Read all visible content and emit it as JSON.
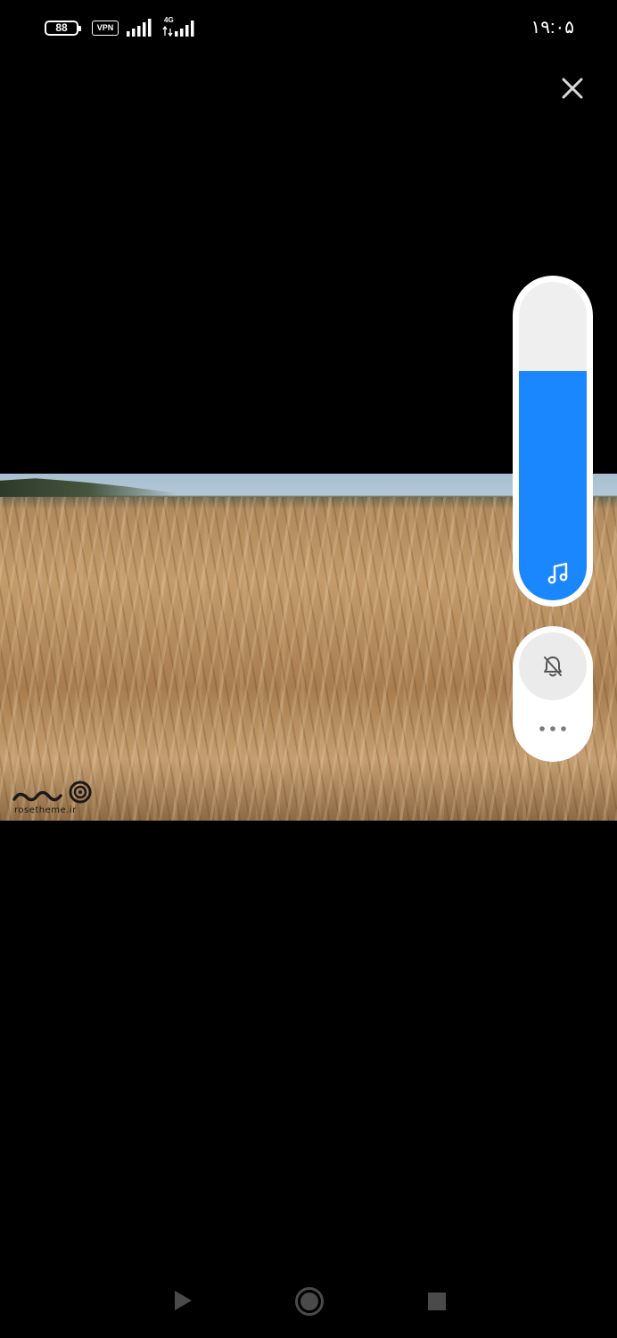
{
  "status_bar": {
    "battery_level": "88",
    "vpn_label": "VPN",
    "network_type": "4G",
    "time": "۱۹:۰۵"
  },
  "media": {
    "watermark_text": "rosetheme.ir"
  },
  "volume": {
    "level": 0.72,
    "accent_color": "#1b87ff",
    "stream_icon": "music-note-icon",
    "mute_icon": "bell-off-icon",
    "more_icon": "more-dots-icon"
  },
  "icons": {
    "close": "close-icon",
    "nav_back": "triangle-back-icon",
    "nav_home": "circle-home-icon",
    "nav_recents": "square-recents-icon"
  }
}
